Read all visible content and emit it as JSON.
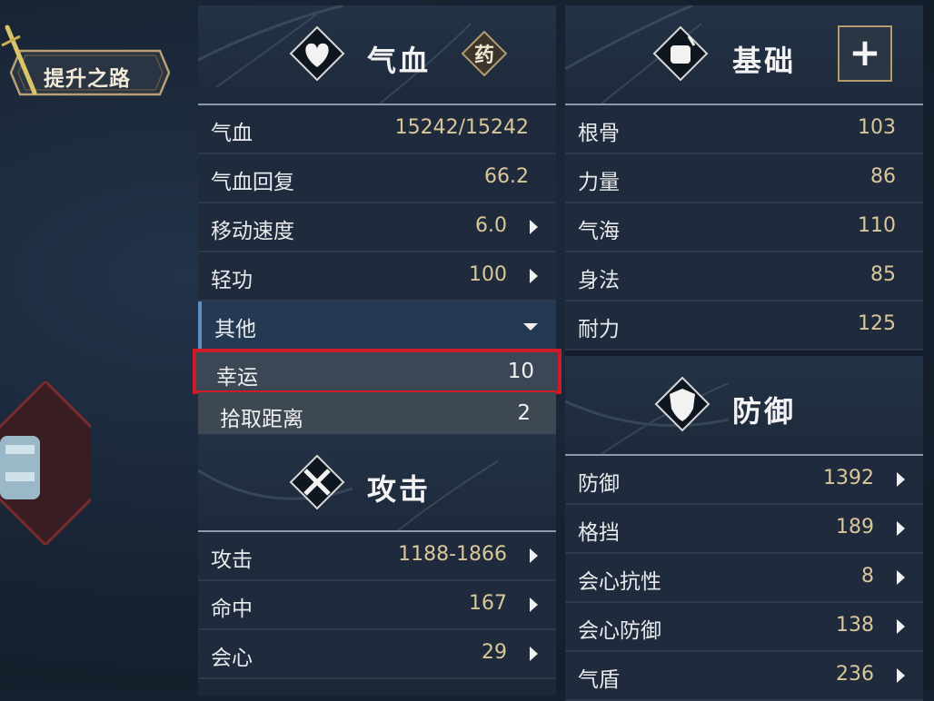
{
  "back_tab": {
    "label": "提升之路"
  },
  "panels": {
    "qixue": {
      "title": "气血",
      "medicine_label": "药",
      "rows": [
        {
          "label": "气血",
          "value": "15242/15242",
          "arrow": false
        },
        {
          "label": "气血回复",
          "value": "66.2",
          "arrow": false
        },
        {
          "label": "移动速度",
          "value": "6.0",
          "arrow": true
        },
        {
          "label": "轻功",
          "value": "100",
          "arrow": true
        }
      ],
      "other": {
        "label": "其他"
      },
      "sub_rows": [
        {
          "label": "幸运",
          "value": "10"
        },
        {
          "label": "拾取距离",
          "value": "2"
        }
      ]
    },
    "attack": {
      "title": "攻击",
      "rows": [
        {
          "label": "攻击",
          "value": "1188-1866",
          "arrow": true
        },
        {
          "label": "命中",
          "value": "167",
          "arrow": true
        },
        {
          "label": "会心",
          "value": "29",
          "arrow": true
        }
      ]
    },
    "basic": {
      "title": "基础",
      "add_label": "+",
      "rows": [
        {
          "label": "根骨",
          "value": "103"
        },
        {
          "label": "力量",
          "value": "86"
        },
        {
          "label": "气海",
          "value": "110"
        },
        {
          "label": "身法",
          "value": "85"
        },
        {
          "label": "耐力",
          "value": "125"
        }
      ]
    },
    "defense": {
      "title": "防御",
      "rows": [
        {
          "label": "防御",
          "value": "1392",
          "arrow": true
        },
        {
          "label": "格挡",
          "value": "189",
          "arrow": true
        },
        {
          "label": "会心抗性",
          "value": "8",
          "arrow": true
        },
        {
          "label": "会心防御",
          "value": "138",
          "arrow": true
        },
        {
          "label": "气盾",
          "value": "236",
          "arrow": true
        }
      ]
    }
  },
  "colors": {
    "highlight": "#cf1b26",
    "value_gold": "#d9c79a",
    "selected_bar": "#5b8fc4"
  }
}
